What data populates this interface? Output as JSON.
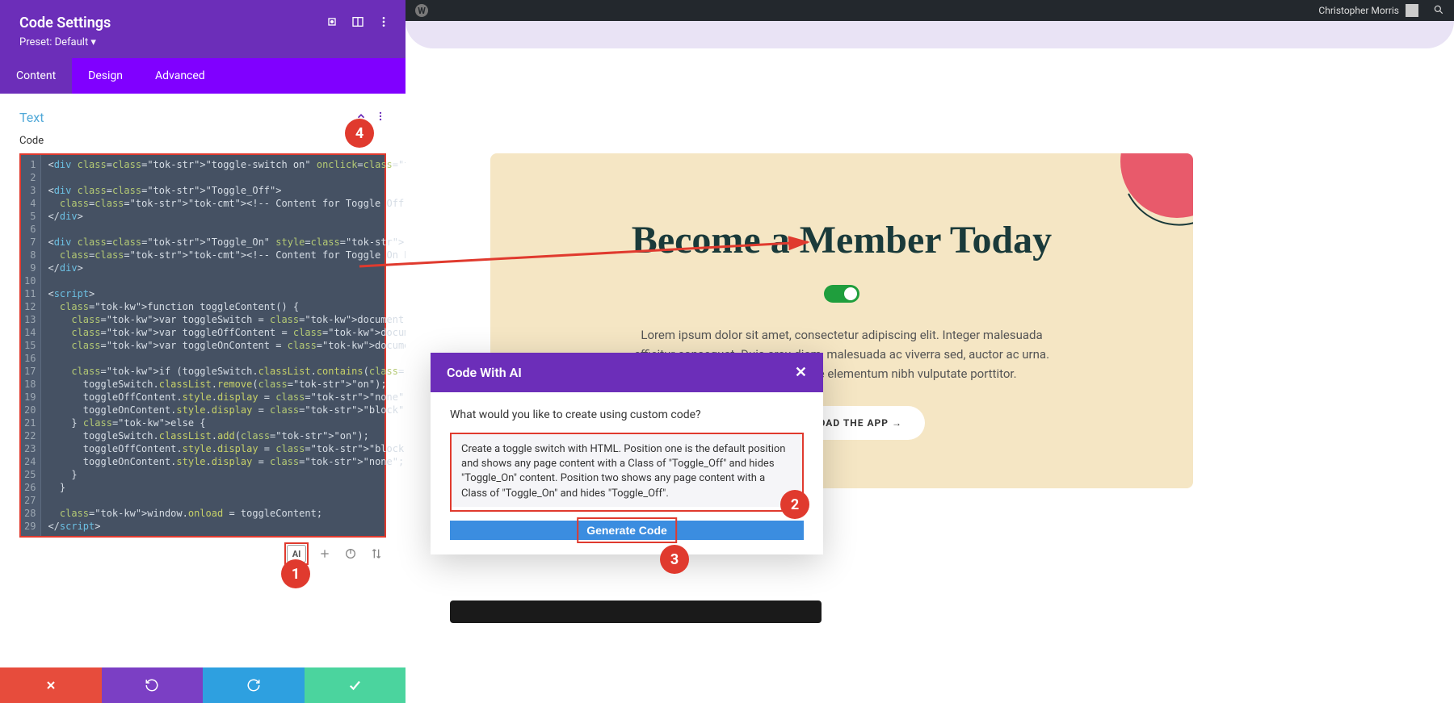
{
  "panel": {
    "title": "Code Settings",
    "preset": "Preset: Default ▾",
    "tabs": [
      "Content",
      "Design",
      "Advanced"
    ],
    "active_tab": 0,
    "section_title": "Text",
    "code_label": "Code"
  },
  "code": {
    "lines": [
      "<div class=\"toggle-switch on\" onclick=\"toggleContent()\"></div>",
      "",
      "<div class=\"Toggle_Off\">",
      "  <!-- Content for Toggle Off Position -->",
      "</div>",
      "",
      "<div class=\"Toggle_On\" style=\"display: none\">",
      "  <!-- Content for Toggle On Position -->",
      "</div>",
      "",
      "<script>",
      "  function toggleContent() {",
      "    var toggleSwitch = document.querySelector(\".toggle-switch\");",
      "    var toggleOffContent = document.getElementById(\"Toggle_Off\");",
      "    var toggleOnContent = document.getElementById(\"Toggle_On\");",
      "",
      "    if (toggleSwitch.classList.contains(\"on\")) {",
      "      toggleSwitch.classList.remove(\"on\");",
      "      toggleOffContent.style.display = \"none\";",
      "      toggleOnContent.style.display = \"block\";",
      "    } else {",
      "      toggleSwitch.classList.add(\"on\");",
      "      toggleOffContent.style.display = \"block\";",
      "      toggleOnContent.style.display = \"none\";",
      "    }",
      "  }",
      "",
      "  window.onload = toggleContent;",
      "</script>"
    ],
    "line_count": 29
  },
  "toolbar": {
    "ai_label": "AI"
  },
  "wp": {
    "user": "Christopher Morris"
  },
  "hero": {
    "title": "Become a Member Today",
    "text": "Lorem ipsum dolor sit amet, consectetur adipiscing elit. Integer malesuada efficitur consequat. Duis arcu diam, malesuada ac viverra sed, auctor ac urna. Nulla posuere mollis mi, vitae elementum nibh vulputate porttitor.",
    "button": "DOWNLOAD THE APP →"
  },
  "ai_modal": {
    "title": "Code With AI",
    "question": "What would you like to create using custom code?",
    "prompt": "Create a toggle switch with HTML. Position one is the default position and shows any page content with a Class of \"Toggle_Off\" and hides \"Toggle_On\" content. Position two shows any page content with a Class of \"Toggle_On\" and hides \"Toggle_Off\".",
    "generate": "Generate Code"
  },
  "callouts": {
    "c1": "1",
    "c2": "2",
    "c3": "3",
    "c4": "4"
  }
}
